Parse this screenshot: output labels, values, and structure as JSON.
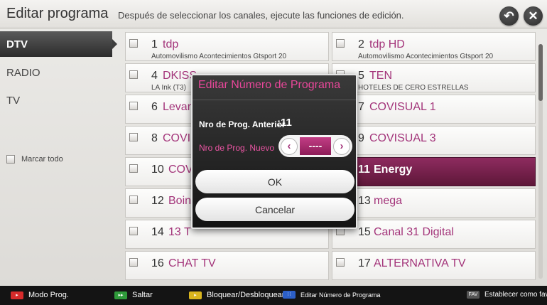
{
  "header": {
    "title": "Editar programa",
    "subtitle": "Después de seleccionar los canales, ejecute las funciones de edición.",
    "back_icon": "back-arrow-icon",
    "close_icon": "close-icon"
  },
  "sidebar": {
    "items": [
      {
        "label": "DTV",
        "active": true
      },
      {
        "label": "RADIO",
        "active": false
      },
      {
        "label": "TV",
        "active": false
      }
    ],
    "mark_all_label": "Marcar todo"
  },
  "channels": [
    {
      "num": "1",
      "name": "tdp",
      "sub": "Automovilismo Acontecimientos Gtsport 20"
    },
    {
      "num": "2",
      "name": "tdp HD",
      "sub": "Automovilismo Acontecimientos Gtsport 20"
    },
    {
      "num": "4",
      "name": "DKISS",
      "sub": "LA Ink (T3)"
    },
    {
      "num": "5",
      "name": "TEN",
      "sub": "HOTELES DE CERO ESTRELLAS"
    },
    {
      "num": "6",
      "name": "Levar",
      "sub": ""
    },
    {
      "num": "7",
      "name": "COVISUAL 1",
      "sub": ""
    },
    {
      "num": "8",
      "name": "COVIS",
      "sub": ""
    },
    {
      "num": "9",
      "name": "COVISUAL 3",
      "sub": ""
    },
    {
      "num": "10",
      "name": "COV",
      "sub": ""
    },
    {
      "num": "11",
      "name": "Energy",
      "sub": ""
    },
    {
      "num": "12",
      "name": "Boin",
      "sub": ""
    },
    {
      "num": "13",
      "name": "mega",
      "sub": ""
    },
    {
      "num": "14",
      "name": "13 T",
      "sub": ""
    },
    {
      "num": "15",
      "name": "Canal 31 Digital",
      "sub": ""
    },
    {
      "num": "16",
      "name": "CHAT TV",
      "sub": ""
    },
    {
      "num": "17",
      "name": "ALTERNATIVA TV",
      "sub": ""
    }
  ],
  "selected_channel": "11",
  "dialog": {
    "title": "Editar Número de Programa",
    "prev_label": "Nro de Prog. Anterior",
    "prev_value": ":11",
    "new_label": "Nro de Prog. Nuevo",
    "new_value": "----",
    "ok_label": "OK",
    "cancel_label": "Cancelar"
  },
  "footer": {
    "hints": [
      {
        "key_color": "#d62b2b",
        "key_label": "",
        "label": "Modo Prog."
      },
      {
        "key_color": "#2f9a3a",
        "key_label": "",
        "label": "Saltar"
      },
      {
        "key_color": "#d9b51e",
        "key_label": "",
        "label": "Bloquear/Desbloquear"
      },
      {
        "key_color": "#2c5fc7",
        "key_label": "",
        "label": "Editar Número de Programa"
      },
      {
        "key_color": "#555555",
        "key_label": "FAV",
        "label": "Establecer como favorito"
      }
    ]
  },
  "colors": {
    "accent": "#a3347a",
    "selected_row": "#7a2350",
    "dialog_title": "#e9479a"
  }
}
